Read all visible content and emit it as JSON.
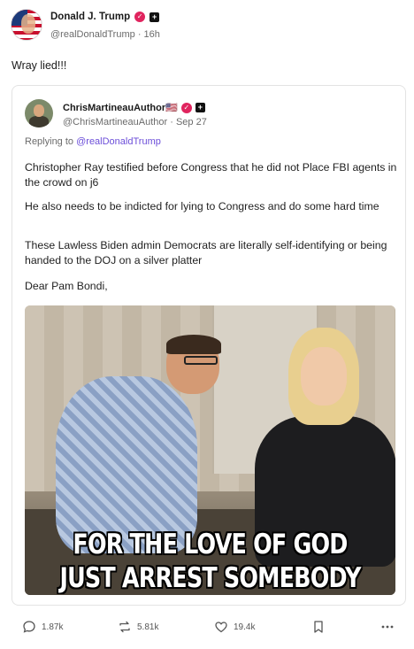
{
  "post": {
    "author_name": "Donald J. Trump",
    "handle": "@realDonaldTrump",
    "time": "16h",
    "text": "Wray lied!!!"
  },
  "quoted": {
    "author_name": "ChrisMartineauAuthor🇺🇸",
    "handle": "@ChrisMartineauAuthor",
    "date": "Sep 27",
    "replying_prefix": "Replying to",
    "replying_to": "@realDonaldTrump",
    "paragraphs": [
      "Christopher Ray testified before Congress that he did not Place FBI agents in the crowd on j6",
      "He also needs to be indicted for lying to Congress and do some hard time",
      "These Lawless Biden admin Democrats are literally self-identifying or being handed to the DOJ on a silver platter",
      "Dear Pam Bondi,"
    ],
    "meme_caption_line1": "FOR THE LOVE OF GOD",
    "meme_caption_line2": "JUST ARREST SOMEBODY"
  },
  "actions": {
    "replies": "1.87k",
    "reposts": "5.81k",
    "likes": "19.4k"
  },
  "colors": {
    "verified_badge": "#e0245e",
    "mention": "#6c4ed9"
  }
}
